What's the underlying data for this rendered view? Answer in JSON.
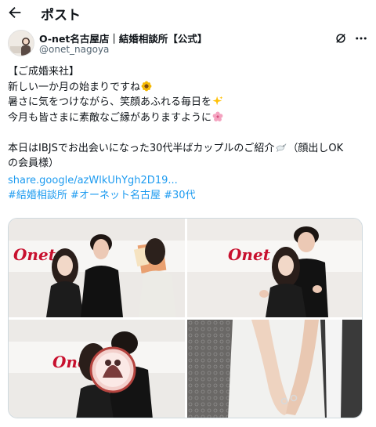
{
  "header": {
    "title": "ポスト"
  },
  "author": {
    "name": "O-net名古屋店｜結婚相談所【公式】",
    "handle": "@onet_nagoya"
  },
  "post": {
    "lines": [
      "【ご成婚来社】",
      "新しい一か月の始まりですね",
      "暑さに気をつけながら、笑顔あふれる毎日を",
      "今月も皆さまに素敵なご縁がありますように",
      "",
      "本日はIBJSでお出会いになった30代半ばカップルのご紹介",
      "（顔出しOK",
      "の会員様）"
    ],
    "link": "share.google/azWlkUhYgh2D19...",
    "hashtags": [
      "#結婚相談所",
      "#オーネット名古屋",
      "#30代"
    ]
  },
  "media": {
    "brand_text": "Onet",
    "photos": [
      "couple-photo-1",
      "couple-photo-2",
      "couple-photo-3",
      "couple-photo-4"
    ]
  },
  "icons": {
    "back": "arrow-left-icon",
    "grok": "grok-icon",
    "more": "more-icon",
    "sunflower": "sunflower-emoji",
    "sparkles": "sparkles-emoji",
    "blossom": "cherry-blossom-emoji",
    "dove": "dove-emoji"
  },
  "colors": {
    "link": "#1d9bf0",
    "text": "#0f1419",
    "muted": "#536471",
    "brand_red": "#c8102e"
  }
}
